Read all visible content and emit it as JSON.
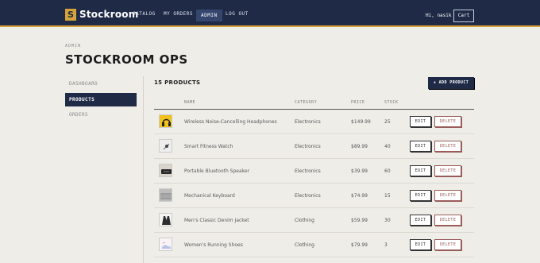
{
  "app": {
    "logo_badge": "S",
    "title": "Stockroom"
  },
  "nav": {
    "catalog": "CATALOG",
    "orders": "MY ORDERS",
    "admin": "ADMIN",
    "logout": "LOG OUT",
    "greeting": "Hi, nasik",
    "cart": "Cart"
  },
  "header": {
    "eyebrow": "ADMIN",
    "title": "STOCKROOM OPS"
  },
  "sidebar": {
    "items": [
      {
        "label": "DASHBOARD"
      },
      {
        "label": "PRODUCTS"
      },
      {
        "label": "ORDERS"
      }
    ]
  },
  "main": {
    "count": "15 PRODUCTS",
    "add_label": "+ ADD PRODUCT",
    "columns": {
      "name": "NAME",
      "category": "CATEGORY",
      "price": "PRICE",
      "stock": "STOCK"
    },
    "edit_label": "EDIT",
    "delete_label": "DELETE",
    "rows": [
      {
        "name": "Wireless Noise-Cancelling Headphones",
        "category": "Electronics",
        "price": "$149.99",
        "stock": "25",
        "thumb_icon": "headphones-icon"
      },
      {
        "name": "Smart Fitness Watch",
        "category": "Electronics",
        "price": "$89.99",
        "stock": "40",
        "thumb_icon": "watch-icon"
      },
      {
        "name": "Portable Bluetooth Speaker",
        "category": "Electronics",
        "price": "$39.99",
        "stock": "60",
        "thumb_icon": "speaker-icon"
      },
      {
        "name": "Mechanical Keyboard",
        "category": "Electronics",
        "price": "$74.99",
        "stock": "15",
        "thumb_icon": "keyboard-icon"
      },
      {
        "name": "Men's Classic Denim Jacket",
        "category": "Clothing",
        "price": "$59.99",
        "stock": "30",
        "thumb_icon": "jacket-icon"
      },
      {
        "name": "Women's Running Shoes",
        "category": "Clothing",
        "price": "$79.99",
        "stock": "3",
        "thumb_icon": "shoes-icon"
      }
    ]
  },
  "colors": {
    "navy": "#1f2a47",
    "gold": "#d6a23a",
    "delete": "#9a5b58",
    "background": "#efede8"
  }
}
